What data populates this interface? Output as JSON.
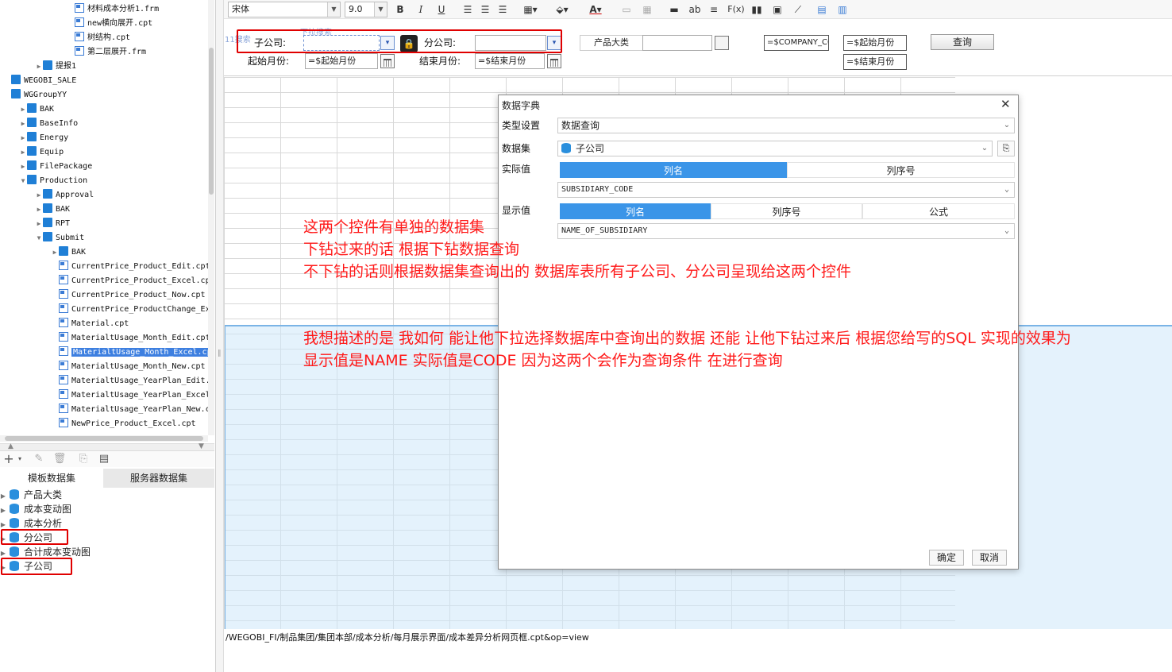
{
  "file_tree": [
    {
      "label": "材料成本分析1.frm",
      "type": "file",
      "depth": 4,
      "arrow": ""
    },
    {
      "label": "new横向展开.cpt",
      "type": "file",
      "depth": 4,
      "arrow": ""
    },
    {
      "label": "树结构.cpt",
      "type": "file",
      "depth": 4,
      "arrow": ""
    },
    {
      "label": "第二层展开.frm",
      "type": "file",
      "depth": 4,
      "arrow": ""
    },
    {
      "label": "提报1",
      "type": "folder",
      "depth": 2,
      "arrow": "▶"
    },
    {
      "label": "WEGOBI_SALE",
      "type": "folder",
      "depth": 0,
      "arrow": ""
    },
    {
      "label": "WGGroupYY",
      "type": "folder",
      "depth": 0,
      "arrow": ""
    },
    {
      "label": "BAK",
      "type": "folder",
      "depth": 1,
      "arrow": "▶"
    },
    {
      "label": "BaseInfo",
      "type": "folder",
      "depth": 1,
      "arrow": "▶"
    },
    {
      "label": "Energy",
      "type": "folder",
      "depth": 1,
      "arrow": "▶"
    },
    {
      "label": "Equip",
      "type": "folder",
      "depth": 1,
      "arrow": "▶"
    },
    {
      "label": "FilePackage",
      "type": "folder",
      "depth": 1,
      "arrow": "▶"
    },
    {
      "label": "Production",
      "type": "folder",
      "depth": 1,
      "arrow": "▼"
    },
    {
      "label": "Approval",
      "type": "folder",
      "depth": 2,
      "arrow": "▶"
    },
    {
      "label": "BAK",
      "type": "folder",
      "depth": 2,
      "arrow": "▶"
    },
    {
      "label": "RPT",
      "type": "folder",
      "depth": 2,
      "arrow": "▶"
    },
    {
      "label": "Submit",
      "type": "folder",
      "depth": 2,
      "arrow": "▼"
    },
    {
      "label": "BAK",
      "type": "folder",
      "depth": 3,
      "arrow": "▶"
    },
    {
      "label": "CurrentPrice_Product_Edit.cpt",
      "type": "file",
      "depth": 3,
      "arrow": ""
    },
    {
      "label": "CurrentPrice_Product_Excel.cpt",
      "type": "file",
      "depth": 3,
      "arrow": ""
    },
    {
      "label": "CurrentPrice_Product_Now.cpt",
      "type": "file",
      "depth": 3,
      "arrow": ""
    },
    {
      "label": "CurrentPrice_ProductChange_Exc",
      "type": "file",
      "depth": 3,
      "arrow": ""
    },
    {
      "label": "Material.cpt",
      "type": "file",
      "depth": 3,
      "arrow": ""
    },
    {
      "label": "MaterialtUsage_Month_Edit.cpt",
      "type": "file",
      "depth": 3,
      "arrow": ""
    },
    {
      "label": "MaterialtUsage_Month_Excel.cpt",
      "type": "file",
      "depth": 3,
      "arrow": "",
      "selected": true
    },
    {
      "label": "MaterialtUsage_Month_New.cpt",
      "type": "file",
      "depth": 3,
      "arrow": ""
    },
    {
      "label": "MaterialtUsage_YearPlan_Edit.c",
      "type": "file",
      "depth": 3,
      "arrow": ""
    },
    {
      "label": "MaterialtUsage_YearPlan_Excel.",
      "type": "file",
      "depth": 3,
      "arrow": ""
    },
    {
      "label": "MaterialtUsage_YearPlan_New.cp",
      "type": "file",
      "depth": 3,
      "arrow": ""
    },
    {
      "label": "NewPrice_Product_Excel.cpt",
      "type": "file",
      "depth": 3,
      "arrow": ""
    }
  ],
  "dataset_panel": {
    "tabs": [
      "模板数据集",
      "服务器数据集"
    ],
    "active_tab": 0,
    "toolbar_icons": [
      "add-icon",
      "edit-icon",
      "delete-icon",
      "preview-icon",
      "server-dataset-icon"
    ],
    "datasets": [
      "产品大类",
      "成本变动图",
      "成本分析",
      "分公司",
      "合计成本变动图",
      "子公司"
    ]
  },
  "toolbar": {
    "font_name": "宋体",
    "font_size": "9.0",
    "bold": "B",
    "italic": "I",
    "underline": "U",
    "text_btn": "ab",
    "formula_btn": "F(x)"
  },
  "params": {
    "subsidiary_label": "子公司:",
    "branch_label": "分公司:",
    "product_label": "产品大类",
    "start_month_label": "起始月份:",
    "start_month_value": "=$起始月份",
    "end_month_label": "结束月份:",
    "end_month_value": "=$结束月份",
    "company_cell": "=$COMPANY_COD",
    "start_cell": "=$起始月份",
    "end_cell": "=$结束月份",
    "query_button": "查询",
    "hidden_tag_1": "11搜索",
    "hidden_tag_2": "下拉搜索"
  },
  "status_path": "/WEGOBI_FI/制品集团/集团本部/成本分析/每月展示界面/成本差异分析网页框.cpt&op=view",
  "dialog": {
    "title": "数据字典",
    "type_label": "类型设置",
    "type_value": "数据查询",
    "dataset_label": "数据集",
    "dataset_value": "子公司",
    "actual_label": "实际值",
    "actual_tabs": [
      "列名",
      "列序号"
    ],
    "actual_value": "SUBSIDIARY_CODE",
    "display_label": "显示值",
    "display_tabs": [
      "列名",
      "列序号",
      "公式"
    ],
    "display_value": "NAME_OF_SUBSIDIARY",
    "ok": "确定",
    "cancel": "取消"
  },
  "annotations": {
    "line1": "这两个控件有单独的数据集",
    "line2": "下钻过来的话 根据下钻数据查询",
    "line3": "不下钻的话则根据数据集查询出的 数据库表所有子公司、分公司呈现给这两个控件",
    "line4": "我想描述的是 我如何 能让他下拉选择数据库中查询出的数据 还能 让他下钻过来后 根据您给写的SQL  实现的效果为",
    "line5": "显示值是NAME  实际值是CODE   因为这两个会作为查询条件 在进行查询"
  },
  "colors": {
    "accent": "#3b95e8",
    "annotation": "#ff1a1a",
    "highlight_box": "#e00000"
  }
}
